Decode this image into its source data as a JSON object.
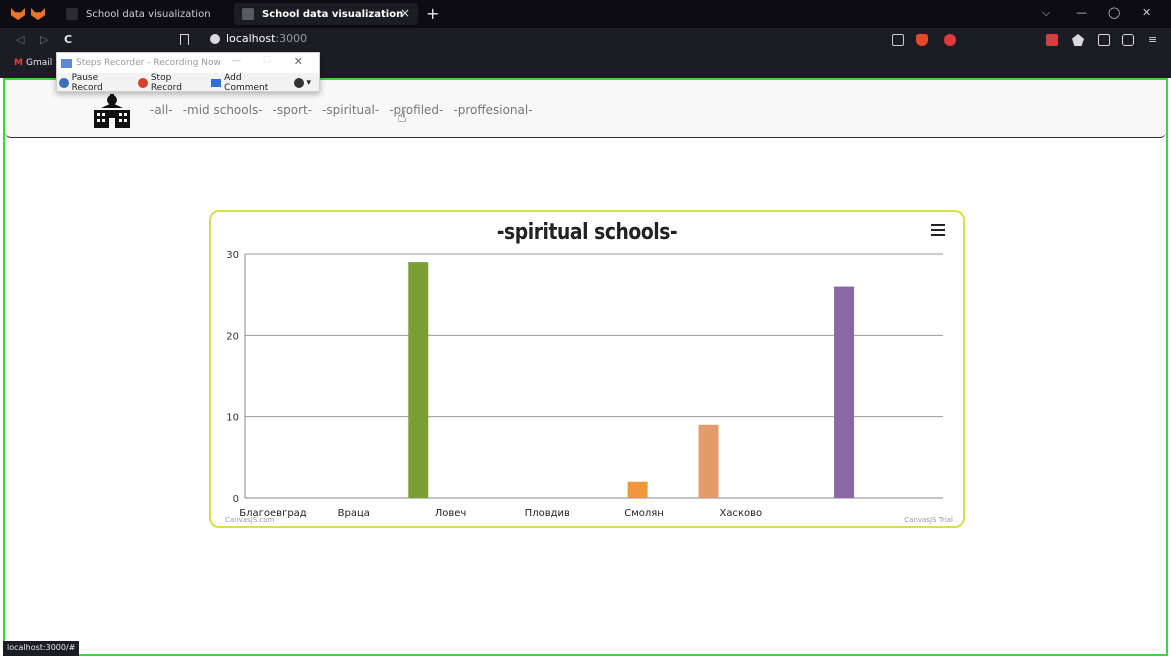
{
  "browser": {
    "tabs": [
      {
        "label": "School data visualization",
        "active": false
      },
      {
        "label": "School data visualization",
        "active": true
      }
    ],
    "new_tab": "+",
    "tab_close": "×",
    "url_host": "localhost",
    "url_port": ":3000",
    "bookmark_gmail": "Gmail",
    "status_url": "localhost:3000/#",
    "window_controls": [
      "⌵",
      "—",
      "◯",
      "✕"
    ]
  },
  "recorder": {
    "title": "Steps Recorder - Recording Now",
    "pause_label": "Pause Record",
    "stop_label": "Stop Record",
    "comment_label": "Add Comment"
  },
  "navbar": {
    "links": [
      "-all-",
      "-mid schools-",
      "-sport-",
      "-spiritual-",
      "-profiled-",
      "-proffesional-"
    ]
  },
  "colors": {
    "accent_border": "#3ad93a",
    "card_border": "#d6e04a"
  },
  "chart_data": {
    "type": "bar",
    "title": "-spiritual schools-",
    "categories": [
      "Благоевград",
      "Враца",
      "Ловеч",
      "Пловдив",
      "Смолян",
      "Хасково"
    ],
    "bars": [
      {
        "x": 2.5,
        "value": 29,
        "color": "#7a9e34"
      },
      {
        "x": 5.9,
        "value": 2,
        "color": "#f0963c"
      },
      {
        "x": 7.0,
        "value": 9,
        "color": "#e59a6a"
      },
      {
        "x": 9.1,
        "value": 26,
        "color": "#8a68a6"
      }
    ],
    "category_x": [
      0,
      1.5,
      3.0,
      4.5,
      6.0,
      7.5
    ],
    "yticks": [
      0,
      10,
      20,
      30
    ],
    "ylim": [
      0,
      30
    ],
    "grid": true,
    "credit_left": "CanvasJS.com",
    "credit_right": "CanvasJS Trial"
  }
}
